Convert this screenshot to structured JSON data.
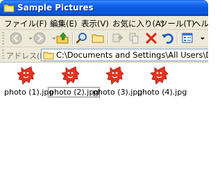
{
  "window": {
    "title": "Sample Pictures"
  },
  "menu": [
    {
      "label": "ファイル(F)"
    },
    {
      "label": "編集(E)"
    },
    {
      "label": "表示(V)"
    },
    {
      "label": "お気に入り(A)"
    },
    {
      "label": "ツール(T)"
    },
    {
      "label": "ヘルプ"
    }
  ],
  "toolbar": {
    "buttons": [
      {
        "name": "back",
        "icon": "back-arrow-icon",
        "enabled": false
      },
      {
        "name": "forward",
        "icon": "forward-arrow-icon",
        "enabled": false
      },
      {
        "name": "up",
        "icon": "folder-up-icon",
        "enabled": true
      },
      {
        "name": "search",
        "icon": "search-icon",
        "enabled": true
      },
      {
        "name": "folders",
        "icon": "folders-icon",
        "enabled": true
      },
      {
        "name": "move-to",
        "icon": "move-to-icon",
        "enabled": false
      },
      {
        "name": "copy-to",
        "icon": "copy-to-icon",
        "enabled": false
      },
      {
        "name": "delete",
        "icon": "delete-x-icon",
        "enabled": true
      },
      {
        "name": "undo",
        "icon": "undo-icon",
        "enabled": true
      },
      {
        "name": "views",
        "icon": "views-icon",
        "enabled": true
      }
    ]
  },
  "address": {
    "label": "アドレス(D)",
    "path": "C:\\Documents and Settings\\All Users\\Documents\\M"
  },
  "files": [
    {
      "name": "photo (1).jpg",
      "focused": false
    },
    {
      "name": "photo (2).jpg",
      "focused": true
    },
    {
      "name": "photo (3).jpg",
      "focused": false
    },
    {
      "name": "photo (4).jpg",
      "focused": false
    }
  ],
  "colors": {
    "titlebar": "#0a5bdc",
    "chrome": "#ece9d8",
    "thumbnail_red": "#e8321e"
  }
}
